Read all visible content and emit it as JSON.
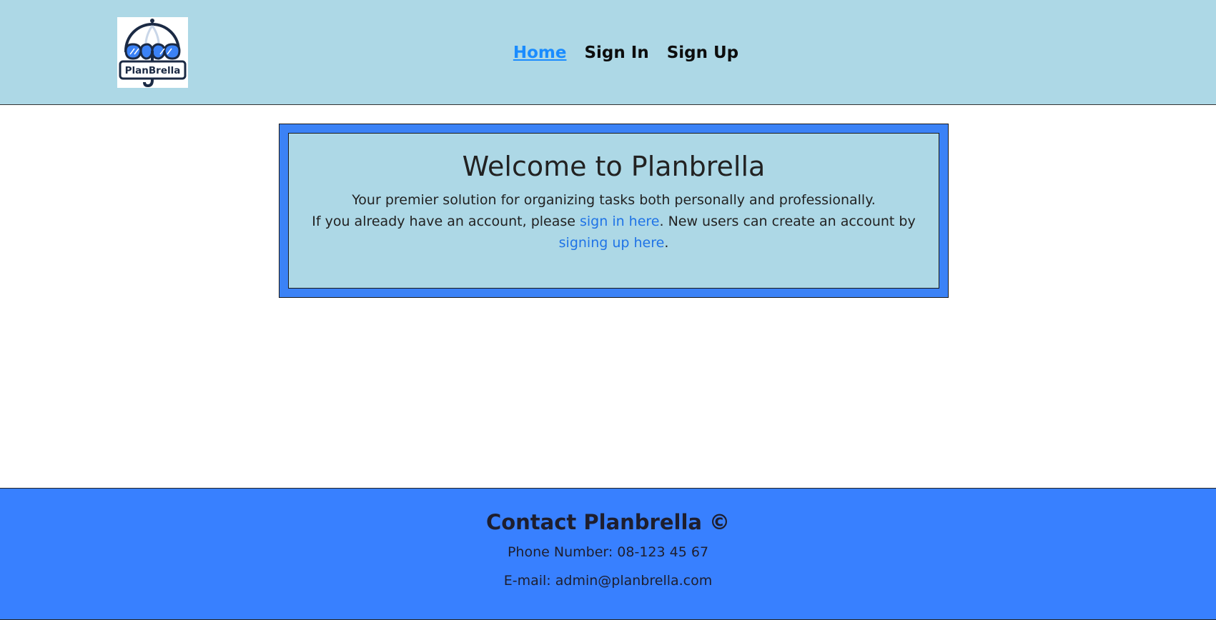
{
  "header": {
    "logo_text": "PlanBrella",
    "nav": [
      {
        "label": "Home",
        "active": true
      },
      {
        "label": "Sign In",
        "active": false
      },
      {
        "label": "Sign Up",
        "active": false
      }
    ]
  },
  "welcome": {
    "title": "Welcome to Planbrella",
    "line1": "Your premier solution for organizing tasks both personally and professionally.",
    "line2_prefix": "If you already have an account, please ",
    "sign_in_link": "sign in here",
    "line2_middle": ". New users can create an account by ",
    "sign_up_link": "signing up here",
    "line2_suffix": "."
  },
  "footer": {
    "title": "Contact Planbrella ©",
    "phone": "Phone Number: 08-123 45 67",
    "email": "E-mail: admin@planbrella.com"
  },
  "colors": {
    "header_bg": "#add8e6",
    "accent_blue": "#3b82f6",
    "link": "#1f73e6",
    "nav_active": "#1a8cff"
  }
}
